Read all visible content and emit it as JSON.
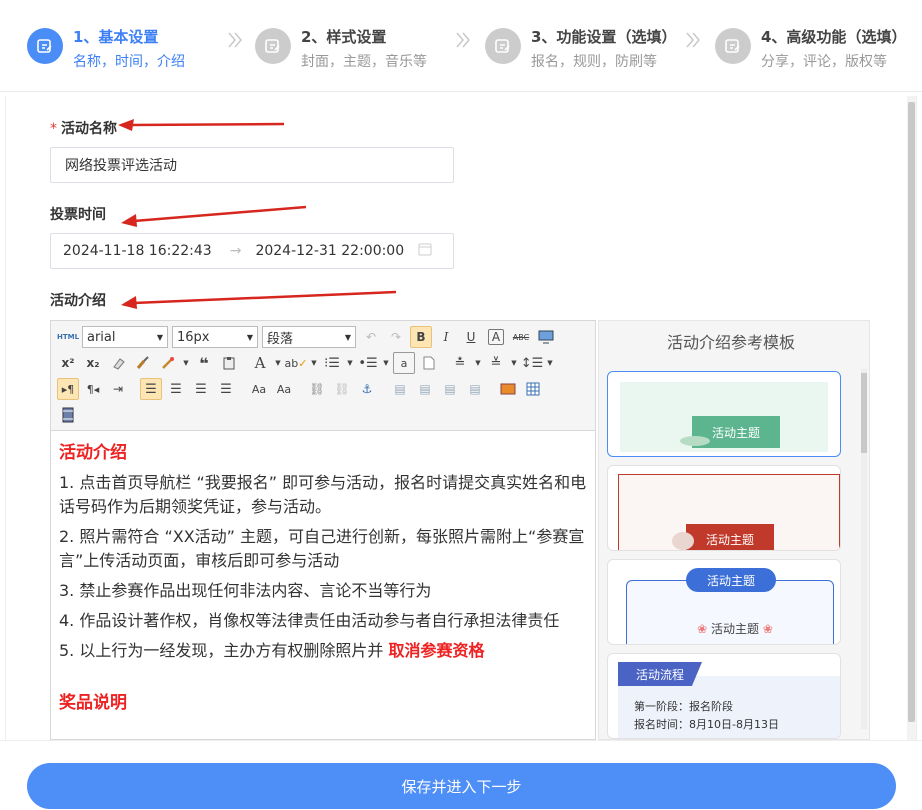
{
  "steps": [
    {
      "title": "1、基本设置",
      "sub": "名称，时间，介绍"
    },
    {
      "title": "2、样式设置",
      "sub": "封面，主题，音乐等"
    },
    {
      "title": "3、功能设置（选填）",
      "sub": "报名，规则，防刷等"
    },
    {
      "title": "4、高级功能（选填）",
      "sub": "分享，评论，版权等"
    }
  ],
  "form": {
    "name_label": "活动名称",
    "name_required": "*",
    "name_value": "网络投票评选活动",
    "time_label": "投票时间",
    "start_time": "2024-11-18 16:22:43",
    "time_sep": "→",
    "end_time": "2024-12-31 22:00:00",
    "intro_label": "活动介绍"
  },
  "toolbar": {
    "html_label": "HTML",
    "font_family": "arial",
    "font_size": "16px",
    "paragraph": "段落"
  },
  "editor": {
    "heading": "活动介绍",
    "items": [
      "1. 点击首页导航栏 “我要报名” 即可参与活动，报名时请提交真实姓名和电话号码作为后期领奖凭证，参与活动。",
      "2. 照片需符合 “XX活动” 主题，可自己进行创新，每张照片需附上“参赛宣言”上传活动页面，审核后即可参与活动",
      "3. 禁止参赛作品出现任何非法内容、言论不当等行为",
      "4. 作品设计著作权，肖像权等法律责任由活动参与者自行承担法律责任"
    ],
    "item5_prefix": "5. 以上行为一经发现，主办方有权删除照片并 ",
    "item5_highlight": "取消参赛资格",
    "next_heading": "奖品说明"
  },
  "templates": {
    "title": "活动介绍参考模板",
    "card1": "活动主题",
    "card2": "活动主题",
    "card3_top": "活动主题",
    "card3_inner": "活动主题",
    "card4_tag": "活动流程",
    "card4_line1": "第一阶段：报名阶段",
    "card4_line2": "报名时间：8月10日-8月13日"
  },
  "footer": {
    "save_label": "保存并进入下一步"
  },
  "colors": {
    "primary": "#4a8df7",
    "red": "#e22222"
  }
}
